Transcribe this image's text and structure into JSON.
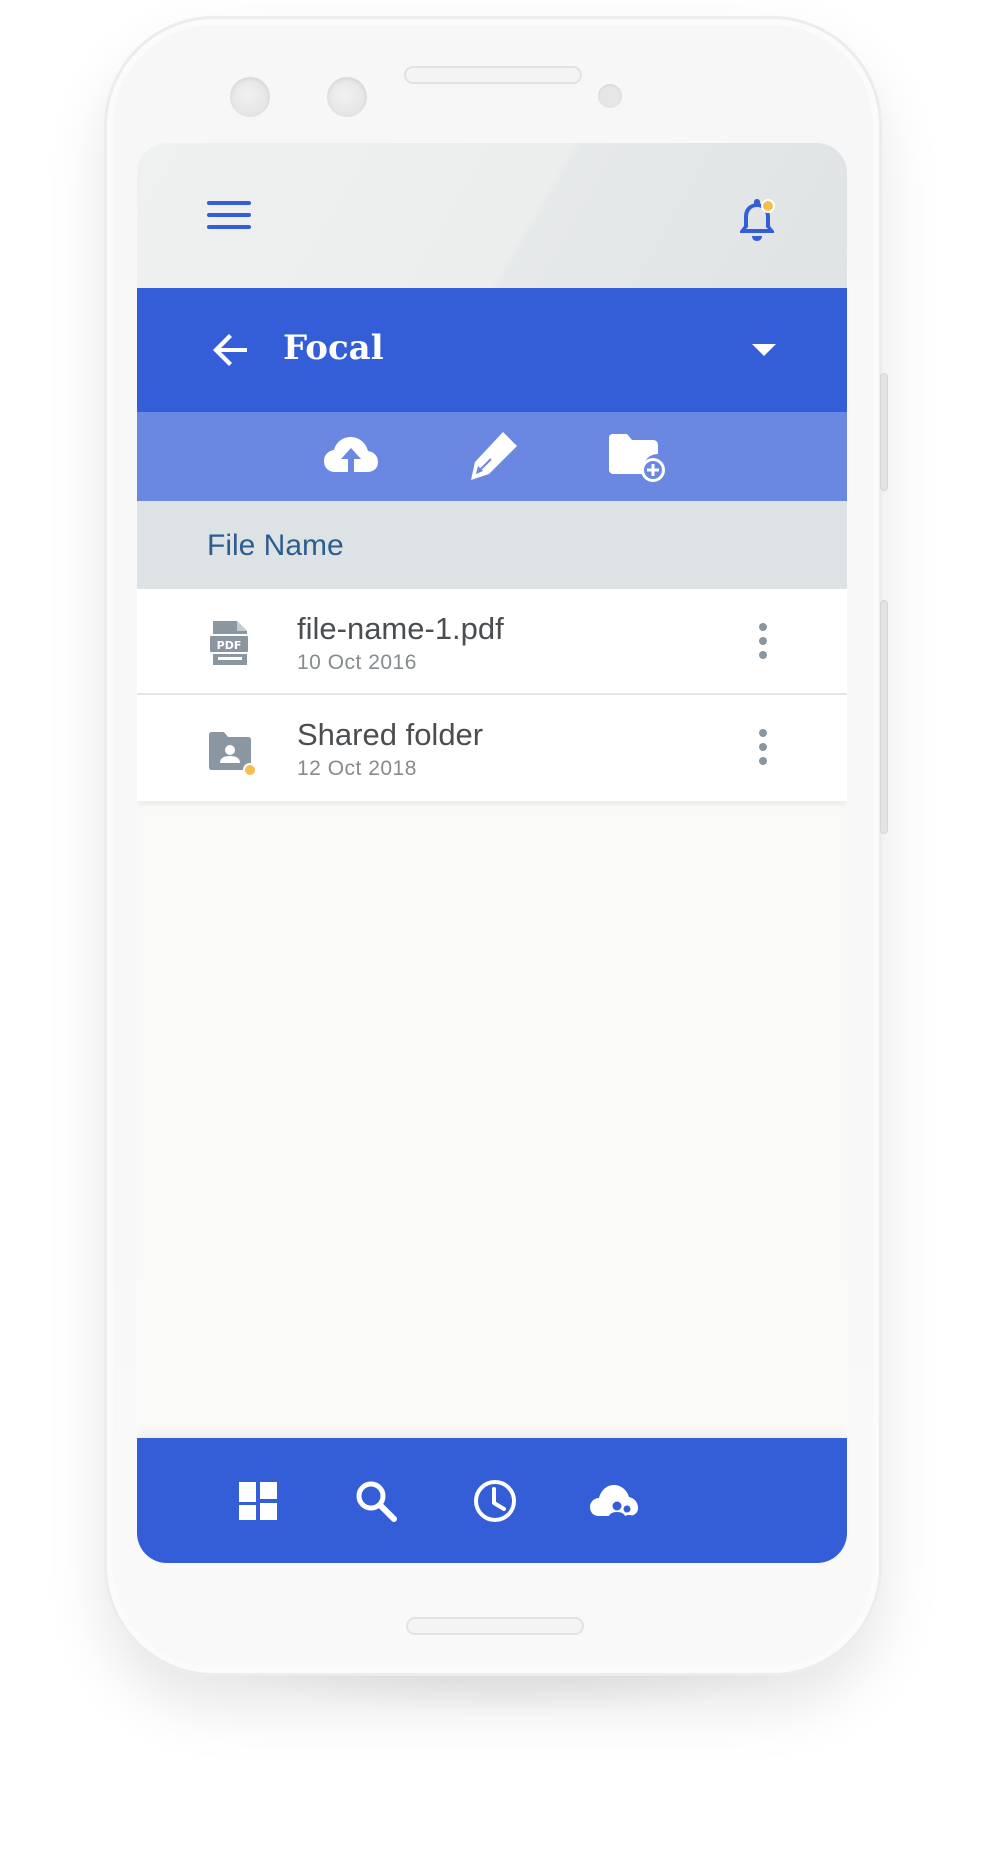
{
  "app": {
    "folder_title": "Focal"
  },
  "icons": {
    "menu": "menu-icon",
    "notifications": "bell-icon",
    "back": "arrow-left-icon",
    "dropdown": "caret-down-icon",
    "upload": "cloud-upload-icon",
    "edit": "pencil-icon",
    "new_folder": "folder-add-icon",
    "pdf": "pdf-file-icon",
    "shared_folder": "shared-folder-icon",
    "more": "more-vertical-icon"
  },
  "file_list": {
    "column_header": "File Name",
    "items": [
      {
        "name": "file-name-1.pdf",
        "date": "10 Oct 2016",
        "type": "pdf"
      },
      {
        "name": "Shared folder",
        "date": "12 Oct 2018",
        "type": "shared-folder",
        "badge": "unread"
      }
    ]
  },
  "bottom_nav": {
    "items": [
      {
        "icon": "dashboard-icon"
      },
      {
        "icon": "search-icon"
      },
      {
        "icon": "recent-clock-icon"
      },
      {
        "icon": "shared-cloud-icon"
      }
    ]
  },
  "colors": {
    "primary": "#345ed7",
    "toolbar": "#6a87e1",
    "header_row": "#dde3e5",
    "accent_dot": "#f6bd4f",
    "file_icon": "#8b97a0"
  }
}
